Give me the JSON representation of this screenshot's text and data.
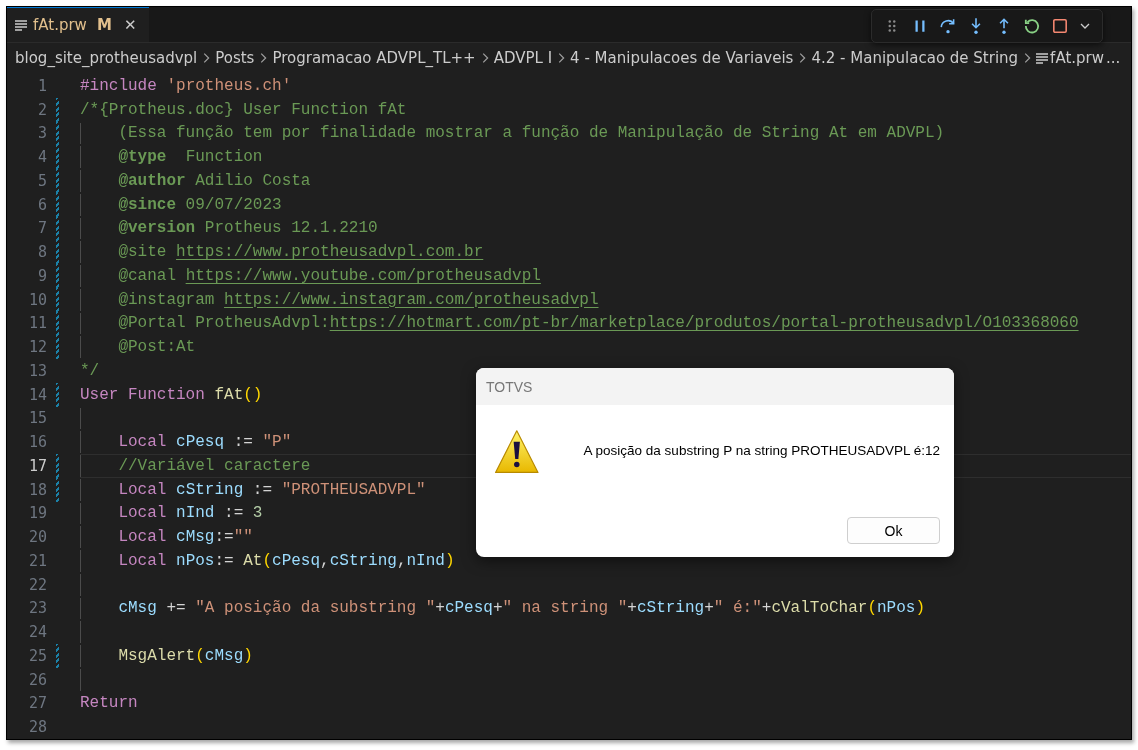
{
  "tab": {
    "title": "fAt.prw",
    "badge": "M",
    "close": "✕",
    "selected": true,
    "modified": true
  },
  "breadcrumb": [
    {
      "label": "blog_site_protheusadvpl",
      "kind": "folder"
    },
    {
      "label": "Posts",
      "kind": "folder"
    },
    {
      "label": "Programacao ADVPL_TL++",
      "kind": "folder"
    },
    {
      "label": "ADVPL I",
      "kind": "folder"
    },
    {
      "label": "4 - Manipulacoes de Variaveis",
      "kind": "folder"
    },
    {
      "label": "4.2 - Manipulacao de String",
      "kind": "folder"
    },
    {
      "label": "fAt.prw",
      "kind": "file"
    },
    {
      "label": "...",
      "kind": "more"
    }
  ],
  "debug_toolbar": {
    "buttons": [
      {
        "kind": "grip"
      },
      {
        "kind": "pause"
      },
      {
        "kind": "step_over"
      },
      {
        "kind": "step_into"
      },
      {
        "kind": "step_out"
      },
      {
        "kind": "restart"
      },
      {
        "kind": "stop"
      },
      {
        "kind": "caret"
      }
    ]
  },
  "editor": {
    "lines": [
      {
        "number": "1",
        "changed": false,
        "selected": false,
        "guide": false,
        "tokens": [
          {
            "text": "#include ",
            "kind": "pp"
          },
          {
            "text": "'protheus.ch'",
            "kind": "str"
          }
        ]
      },
      {
        "number": "2",
        "changed": true,
        "selected": false,
        "guide": false,
        "tokens": [
          {
            "text": "/*{Protheus.doc} User Function fAt",
            "kind": "cm"
          }
        ]
      },
      {
        "number": "3",
        "changed": true,
        "selected": false,
        "guide": true,
        "tokens": [
          {
            "text": "    (Essa função tem por finalidade mostrar a função de Manipulação de String At em ADVPL)",
            "kind": "cm"
          }
        ]
      },
      {
        "number": "4",
        "changed": true,
        "selected": false,
        "guide": true,
        "tokens": [
          {
            "text": "    @type",
            "kind": "tag"
          },
          {
            "text": "  Function",
            "kind": "cm"
          }
        ]
      },
      {
        "number": "5",
        "changed": true,
        "selected": false,
        "guide": true,
        "tokens": [
          {
            "text": "    @author",
            "kind": "tag"
          },
          {
            "text": " Adilio Costa",
            "kind": "cm"
          }
        ]
      },
      {
        "number": "6",
        "changed": true,
        "selected": false,
        "guide": true,
        "tokens": [
          {
            "text": "    @since",
            "kind": "tag"
          },
          {
            "text": " 09/07/2023",
            "kind": "cm"
          }
        ]
      },
      {
        "number": "7",
        "changed": true,
        "selected": false,
        "guide": true,
        "tokens": [
          {
            "text": "    @version",
            "kind": "tag"
          },
          {
            "text": " Protheus 12.1.2210",
            "kind": "cm"
          }
        ]
      },
      {
        "number": "8",
        "changed": true,
        "selected": false,
        "guide": true,
        "tokens": [
          {
            "text": "    @site ",
            "kind": "cm"
          },
          {
            "text": "https://www.protheusadvpl.com.br",
            "kind": "link"
          }
        ]
      },
      {
        "number": "9",
        "changed": true,
        "selected": false,
        "guide": true,
        "tokens": [
          {
            "text": "    @canal ",
            "kind": "cm"
          },
          {
            "text": "https://www.youtube.com/protheusadvpl",
            "kind": "link"
          }
        ]
      },
      {
        "number": "10",
        "changed": true,
        "selected": false,
        "guide": true,
        "tokens": [
          {
            "text": "    @instagram ",
            "kind": "cm"
          },
          {
            "text": "https://www.instagram.com/protheusadvpl",
            "kind": "link"
          }
        ]
      },
      {
        "number": "11",
        "changed": true,
        "selected": false,
        "guide": true,
        "tokens": [
          {
            "text": "    @Portal ProtheusAdvpl:",
            "kind": "cm"
          },
          {
            "text": "https://hotmart.com/pt-br/marketplace/produtos/portal-protheusadvpl/O103368060",
            "kind": "link"
          }
        ]
      },
      {
        "number": "12",
        "changed": true,
        "selected": false,
        "guide": true,
        "tokens": [
          {
            "text": "    @Post:At",
            "kind": "cm"
          }
        ]
      },
      {
        "number": "13",
        "changed": false,
        "selected": false,
        "guide": false,
        "tokens": [
          {
            "text": "*/",
            "kind": "cm"
          }
        ]
      },
      {
        "number": "14",
        "changed": true,
        "selected": false,
        "guide": false,
        "tokens": [
          {
            "text": "User Function ",
            "kind": "kw"
          },
          {
            "text": "fAt",
            "kind": "fn"
          },
          {
            "text": "()",
            "kind": "paren"
          }
        ]
      },
      {
        "number": "15",
        "changed": false,
        "selected": false,
        "guide": true
      },
      {
        "number": "16",
        "changed": false,
        "selected": false,
        "guide": true,
        "tokens": [
          {
            "text": "    Local",
            "kind": "kw"
          },
          {
            "text": " cPesq",
            "kind": "var"
          },
          {
            "text": " := ",
            "kind": "op"
          },
          {
            "text": "\"P\"",
            "kind": "str"
          }
        ]
      },
      {
        "number": "17",
        "changed": true,
        "selected": true,
        "guide": true,
        "tokens": [
          {
            "text": "    //Variável caractere",
            "kind": "cm"
          }
        ]
      },
      {
        "number": "18",
        "changed": true,
        "selected": false,
        "guide": true,
        "tokens": [
          {
            "text": "    Local",
            "kind": "kw"
          },
          {
            "text": " cString",
            "kind": "var"
          },
          {
            "text": " := ",
            "kind": "op"
          },
          {
            "text": "\"PROTHEUSADVPL\"",
            "kind": "str"
          }
        ]
      },
      {
        "number": "19",
        "changed": false,
        "selected": false,
        "guide": true,
        "tokens": [
          {
            "text": "    Local",
            "kind": "kw"
          },
          {
            "text": " nInd",
            "kind": "var"
          },
          {
            "text": " := ",
            "kind": "op"
          },
          {
            "text": "3",
            "kind": "num"
          }
        ]
      },
      {
        "number": "20",
        "changed": false,
        "selected": false,
        "guide": true,
        "tokens": [
          {
            "text": "    Local",
            "kind": "kw"
          },
          {
            "text": " cMsg",
            "kind": "var"
          },
          {
            "text": ":=",
            "kind": "op"
          },
          {
            "text": "\"\"",
            "kind": "str"
          }
        ]
      },
      {
        "number": "21",
        "changed": false,
        "selected": false,
        "guide": true,
        "tokens": [
          {
            "text": "    Local",
            "kind": "kw"
          },
          {
            "text": " nPos",
            "kind": "var"
          },
          {
            "text": ":= ",
            "kind": "op"
          },
          {
            "text": "At",
            "kind": "fn"
          },
          {
            "text": "(",
            "kind": "paren"
          },
          {
            "text": "cPesq",
            "kind": "var"
          },
          {
            "text": ",",
            "kind": "op"
          },
          {
            "text": "cString",
            "kind": "var"
          },
          {
            "text": ",",
            "kind": "op"
          },
          {
            "text": "nInd",
            "kind": "var"
          },
          {
            "text": ")",
            "kind": "paren"
          }
        ]
      },
      {
        "number": "22",
        "changed": false,
        "selected": false,
        "guide": true
      },
      {
        "number": "23",
        "changed": false,
        "selected": false,
        "guide": true,
        "tokens": [
          {
            "text": "    cMsg",
            "kind": "var"
          },
          {
            "text": " += ",
            "kind": "op"
          },
          {
            "text": "\"A posição da substring \"",
            "kind": "str"
          },
          {
            "text": "+",
            "kind": "op"
          },
          {
            "text": "cPesq",
            "kind": "var"
          },
          {
            "text": "+",
            "kind": "op"
          },
          {
            "text": "\" na string \"",
            "kind": "str"
          },
          {
            "text": "+",
            "kind": "op"
          },
          {
            "text": "cString",
            "kind": "var"
          },
          {
            "text": "+",
            "kind": "op"
          },
          {
            "text": "\" é:\"",
            "kind": "str"
          },
          {
            "text": "+",
            "kind": "op"
          },
          {
            "text": "cValToChar",
            "kind": "fn"
          },
          {
            "text": "(",
            "kind": "paren"
          },
          {
            "text": "nPos",
            "kind": "var"
          },
          {
            "text": ")",
            "kind": "paren"
          }
        ]
      },
      {
        "number": "24",
        "changed": false,
        "selected": false,
        "guide": true
      },
      {
        "number": "25",
        "changed": true,
        "selected": false,
        "guide": true,
        "tokens": [
          {
            "text": "    MsgAlert",
            "kind": "fn"
          },
          {
            "text": "(",
            "kind": "paren"
          },
          {
            "text": "cMsg",
            "kind": "var"
          },
          {
            "text": ")",
            "kind": "paren"
          }
        ]
      },
      {
        "number": "26",
        "changed": false,
        "selected": false,
        "guide": true
      },
      {
        "number": "27",
        "changed": false,
        "selected": false,
        "guide": false,
        "tokens": [
          {
            "text": "Return",
            "kind": "kw"
          }
        ]
      },
      {
        "number": "28",
        "changed": false,
        "selected": false,
        "guide": false
      }
    ]
  },
  "dialog": {
    "title": "TOTVS",
    "message": "A posição da substring P na string PROTHEUSADVPL é:12",
    "button": "Ok"
  }
}
